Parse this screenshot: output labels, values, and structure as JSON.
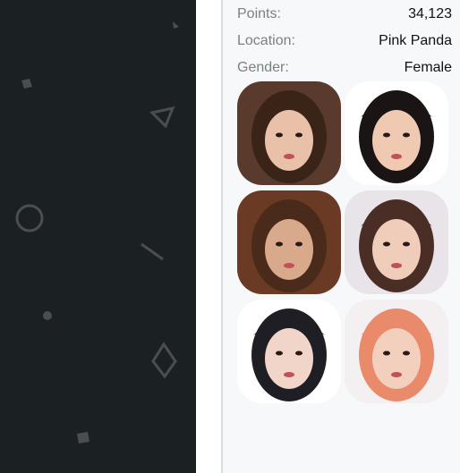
{
  "profile": {
    "points_label": "Points:",
    "points_value": "34,123",
    "location_label": "Location:",
    "location_value": "Pink Panda",
    "gender_label": "Gender:",
    "gender_value": "Female"
  },
  "photos": [
    {
      "name": "photo-1",
      "palette": [
        "#5a3a2c",
        "#e8c1a8",
        "#3a2418"
      ]
    },
    {
      "name": "photo-2",
      "palette": [
        "#ffffff",
        "#efc9b2",
        "#1a1414"
      ]
    },
    {
      "name": "photo-3",
      "palette": [
        "#6a3a24",
        "#d9a98c",
        "#4a2a1a"
      ]
    },
    {
      "name": "photo-4",
      "palette": [
        "#e9e4ea",
        "#f0cdbb",
        "#4a2e26"
      ]
    },
    {
      "name": "photo-5",
      "palette": [
        "#ffffff",
        "#f1d5c8",
        "#1e1e24"
      ]
    },
    {
      "name": "photo-6",
      "palette": [
        "#f4f0f2",
        "#f3cfbe",
        "#e98a6a"
      ]
    }
  ],
  "colors": {
    "left_bg": "#1b2022",
    "shape_color": "#4a4e50"
  }
}
